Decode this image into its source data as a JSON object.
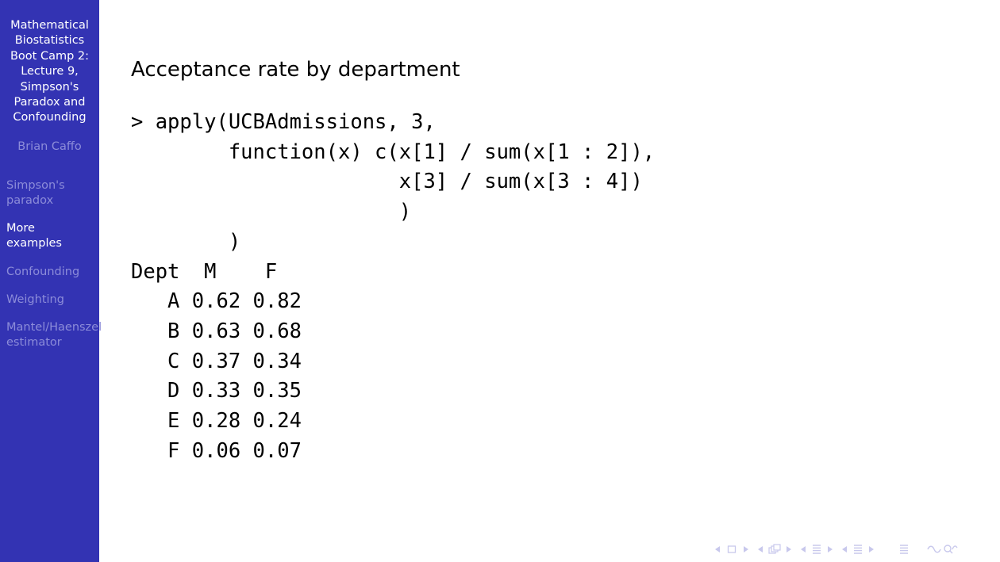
{
  "sidebar": {
    "title": "Mathematical\nBiostatistics\nBoot Camp 2:\nLecture 9,\nSimpson's\nParadox and\nConfounding",
    "author": "Brian Caffo",
    "sections": [
      {
        "label": "Simpson's\nparadox",
        "active": false
      },
      {
        "label": "More\nexamples",
        "active": true
      },
      {
        "label": "Confounding",
        "active": false
      },
      {
        "label": "Weighting",
        "active": false
      },
      {
        "label": "Mantel/Haenszel\nestimator",
        "active": false
      }
    ]
  },
  "slide": {
    "title": "Acceptance rate by department",
    "code": "> apply(UCBAdmissions, 3,\n        function(x) c(x[1] / sum(x[1 : 2]),\n                      x[3] / sum(x[3 : 4])\n                      )\n        )\nDept  M    F\n   A 0.62 0.82\n   B 0.63 0.68\n   C 0.37 0.34\n   D 0.33 0.35\n   E 0.28 0.24\n   F 0.06 0.07"
  },
  "nav_icons": [
    "nav-frame-prev-icon",
    "nav-frame-icon",
    "nav-frame-next-icon",
    "nav-subsection-prev-icon",
    "nav-subsection-icon",
    "nav-subsection-next-icon",
    "nav-section-prev-icon",
    "nav-section-icon",
    "nav-section-next-icon",
    "nav-doc-icon",
    "nav-search-icon"
  ],
  "colors": {
    "sidebar_bg": "#3333b3",
    "sidebar_active": "#ffffff",
    "sidebar_inactive": "#8c8cd9",
    "nav_icon": "#c8c8ec"
  }
}
